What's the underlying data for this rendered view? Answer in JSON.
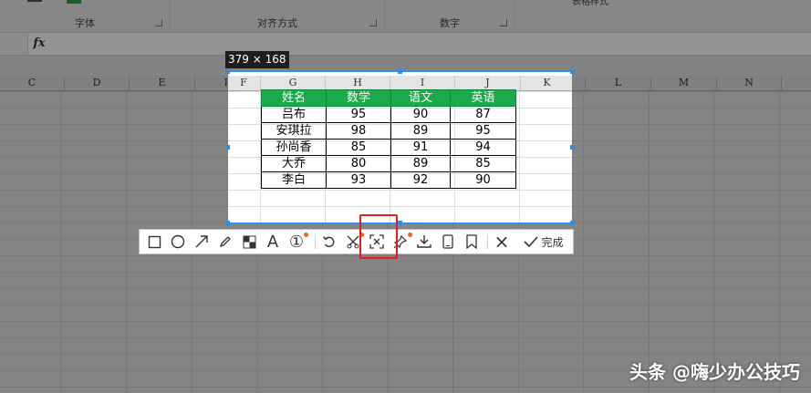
{
  "ribbon": {
    "groups": [
      {
        "label": "字体"
      },
      {
        "label": "对齐方式"
      },
      {
        "label": "数字"
      }
    ],
    "partial_button": "表格样式"
  },
  "formula_bar": {
    "fx_label": "fx"
  },
  "column_headers": [
    "C",
    "D",
    "E",
    "F",
    "G",
    "H",
    "I",
    "J",
    "K",
    "L",
    "M",
    "N"
  ],
  "screenshot_tool": {
    "size_label": "379 × 168",
    "table": {
      "headers": [
        "姓名",
        "数学",
        "语文",
        "英语"
      ],
      "rows": [
        [
          "吕布",
          "95",
          "90",
          "87"
        ],
        [
          "安琪拉",
          "98",
          "89",
          "95"
        ],
        [
          "孙尚香",
          "85",
          "91",
          "94"
        ],
        [
          "大乔",
          "80",
          "89",
          "85"
        ],
        [
          "李白",
          "93",
          "92",
          "90"
        ]
      ]
    },
    "toolbar": {
      "rect_icon": "rectangle-icon",
      "ellipse_icon": "ellipse-icon",
      "arrow_icon": "arrow-icon",
      "pen_icon": "pen-icon",
      "mosaic_icon": "mosaic-icon",
      "text_icon": "A",
      "number_icon": "①",
      "undo_icon": "undo-icon",
      "cut_icon": "cut-icon",
      "ocr_icon": "extract-icon",
      "pin_icon": "pin-icon",
      "download_icon": "download-icon",
      "phone_icon": "phone-icon",
      "bookmark_icon": "bookmark-icon",
      "close_icon": "×",
      "done_label": "完成"
    },
    "accent_color": "#2f8de4",
    "header_fill_color": "#1aaa4a",
    "highlight_color": "#e02020"
  },
  "watermark": "头条 @嗨少办公技巧"
}
